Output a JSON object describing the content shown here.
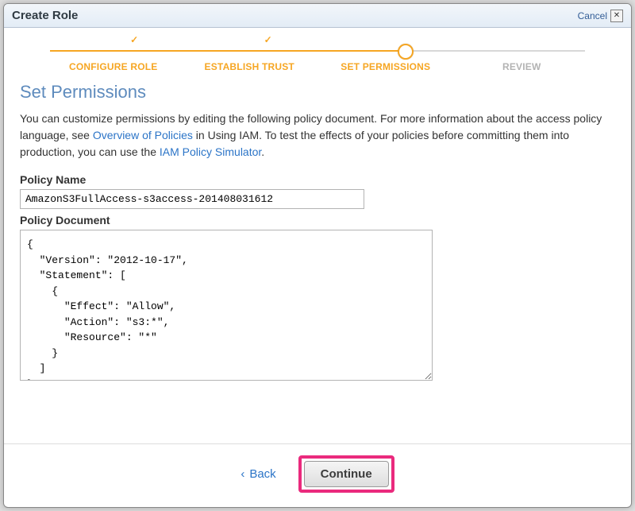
{
  "header": {
    "title": "Create Role",
    "cancel": "Cancel"
  },
  "wizard": {
    "steps": [
      "CONFIGURE ROLE",
      "ESTABLISH TRUST",
      "SET PERMISSIONS",
      "REVIEW"
    ],
    "current_index": 2
  },
  "section": {
    "heading": "Set Permissions"
  },
  "blurb": {
    "p1a": "You can customize permissions by editing the following policy document. For more information about the access policy language, see ",
    "link1": "Overview of Policies",
    "p1b": " in Using IAM. To test the effects of your policies before committing them into production, you can use the ",
    "link2": "IAM Policy Simulator",
    "p1c": "."
  },
  "form": {
    "policy_name_label": "Policy Name",
    "policy_name_value": "AmazonS3FullAccess-s3access-201408031612",
    "policy_doc_label": "Policy Document",
    "policy_doc_value": "{\n  \"Version\": \"2012-10-17\",\n  \"Statement\": [\n    {\n      \"Effect\": \"Allow\",\n      \"Action\": \"s3:*\",\n      \"Resource\": \"*\"\n    }\n  ]\n}"
  },
  "footer": {
    "back": "Back",
    "continue": "Continue"
  }
}
